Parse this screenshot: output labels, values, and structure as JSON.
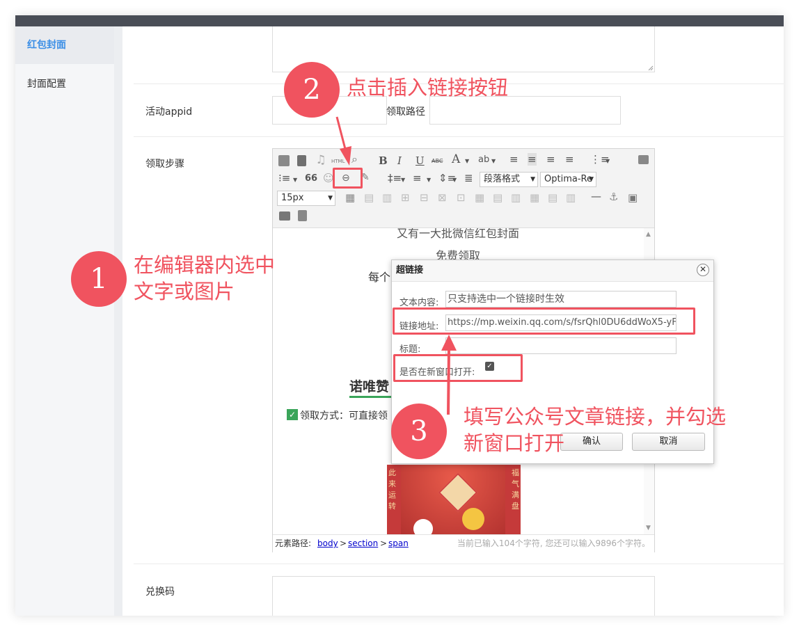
{
  "sidebar": {
    "items": [
      {
        "label": "红包封面",
        "active": true
      },
      {
        "label": "封面配置",
        "active": false
      }
    ]
  },
  "form": {
    "appid_label": "活动appid",
    "path_label": "领取路径",
    "steps_label": "领取步骤",
    "code_label": "兑换码"
  },
  "editor": {
    "toolbar": {
      "html_label": "HTML",
      "bold": "B",
      "italic": "I",
      "underline": "U",
      "strike": "ABC",
      "font_color": "A",
      "quote": "66",
      "paragraph_format": "段落格式",
      "font_family": "Optima-Re",
      "font_size": "15px"
    },
    "content": {
      "line1": "又有一大批微信红包封面",
      "line2": "免费领取",
      "line3_partial": "每个",
      "heading_partial": "诺唯赞",
      "method_partial": "领取方式：可直接领",
      "red_left": [
        "此",
        "来",
        "运",
        "转"
      ],
      "red_right": [
        "福",
        "气",
        "满",
        "盘"
      ]
    },
    "status": {
      "path_label": "元素路径:",
      "path_items": [
        "body",
        "section",
        "span"
      ],
      "sep": ">",
      "count_text": "当前已输入104个字符, 您还可以输入9896个字符。"
    }
  },
  "dialog": {
    "title": "超链接",
    "text_label": "文本内容:",
    "text_value": "只支持选中一个链接时生效",
    "url_label": "链接地址:",
    "url_value": "https://mp.weixin.qq.com/s/fsrQhl0DU6ddWoX5-yF",
    "title_label": "标题:",
    "title_value": "",
    "newwin_label": "是否在新窗口打开:",
    "newwin_checked": true,
    "ok_label": "确认",
    "cancel_label": "取消"
  },
  "annotations": {
    "step1_number": "1",
    "step1_line1": "在编辑器内选中",
    "step1_line2": "文字或图片",
    "step2_number": "2",
    "step2_text": "点击插入链接按钮",
    "step3_number": "3",
    "step3_line1": "填写公众号文章链接，并勾选",
    "step3_line2": "新窗口打开"
  },
  "colors": {
    "accent": "#3a8ee6",
    "annotation": "#f0535f",
    "topbar": "#4a4e57"
  }
}
